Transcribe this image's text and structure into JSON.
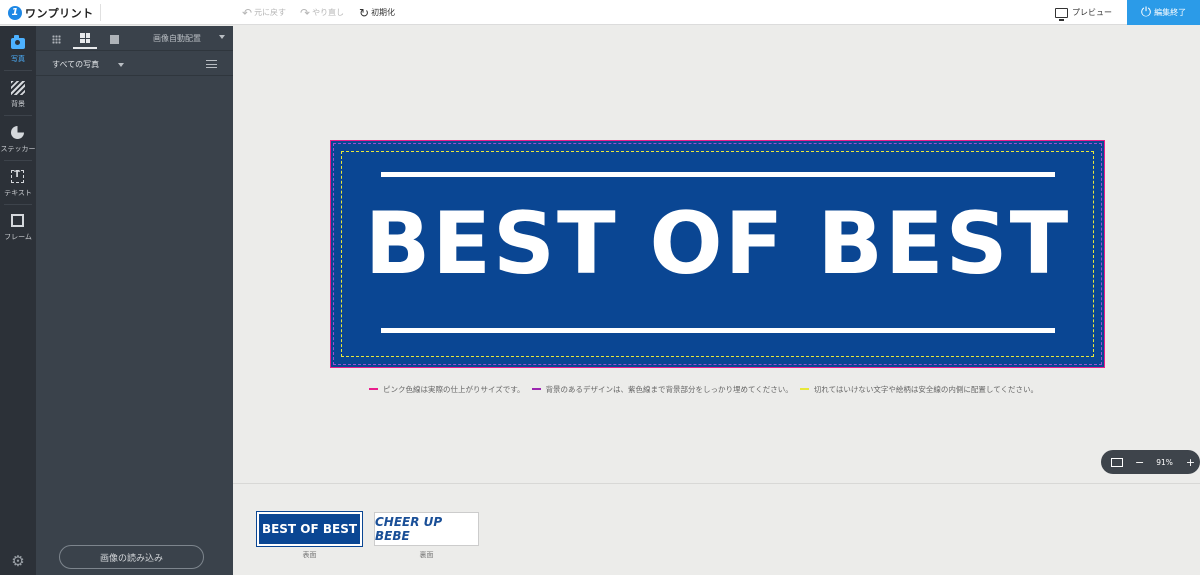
{
  "brand": {
    "name": "ワンプリント",
    "mark": "1"
  },
  "toolbar": {
    "undo": "元に戻す",
    "redo": "やり直し",
    "reset": "初期化",
    "preview": "プレビュー",
    "finish": "編集終了"
  },
  "tools": [
    {
      "label": "写真",
      "active": true
    },
    {
      "label": "背景"
    },
    {
      "label": "ステッカー"
    },
    {
      "label": "テキスト"
    },
    {
      "label": "フレーム"
    }
  ],
  "panel": {
    "auto_arrange": "画像自動配置",
    "filter": "すべての写真",
    "load_button": "画像の読み込み"
  },
  "design": {
    "title": "BEST OF BEST",
    "background": "#0a4693"
  },
  "legend": [
    {
      "color": "#e91e8c",
      "text": "ピンク色線は実際の仕上がりサイズです。"
    },
    {
      "color": "#9c27b0",
      "text": "背景のあるデザインは、紫色線まで背景部分をしっかり埋めてください。"
    },
    {
      "color": "#e8e83a",
      "text": "切れてはいけない文字や絵柄は安全線の内側に配置してください。"
    }
  ],
  "zoom": {
    "minus": "−",
    "value": "91%",
    "plus": "+"
  },
  "pages": [
    {
      "thumb_text": "BEST OF BEST",
      "label": "表面"
    },
    {
      "thumb_text": "CHEER UP BEBE",
      "label": "裏面"
    }
  ]
}
